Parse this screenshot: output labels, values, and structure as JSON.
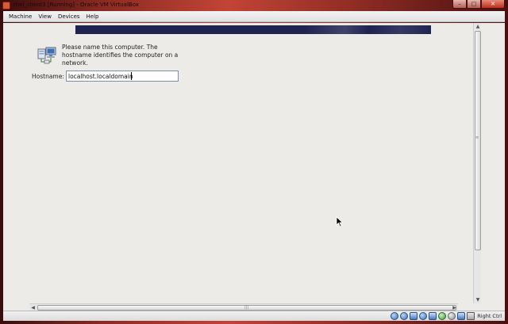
{
  "window": {
    "title": "rhel_client3 [Running] - Oracle VM VirtualBox",
    "controls": {
      "minimize": "–",
      "maximize": "□",
      "close": "✕"
    }
  },
  "menu": {
    "items": [
      {
        "label": "Machine"
      },
      {
        "label": "View"
      },
      {
        "label": "Devices"
      },
      {
        "label": "Help"
      }
    ]
  },
  "installer": {
    "prompt": "Please name this computer.  The hostname identifies the computer on a network.",
    "hostname_label": "Hostname:",
    "hostname_value": "localhost.localdomain",
    "icon": "network-computer-icon"
  },
  "statusbar": {
    "host_key": "Right Ctrl",
    "icons": [
      "hard-disk-icon",
      "optical-drive-icon",
      "usb-icon",
      "network-icon",
      "shared-folder-icon",
      "display-icon",
      "mouse-integration-icon",
      "capture-icon"
    ]
  },
  "colors": {
    "banner": "#1f2350",
    "guest_background": "#ecebe8",
    "frame": "#c24436"
  }
}
